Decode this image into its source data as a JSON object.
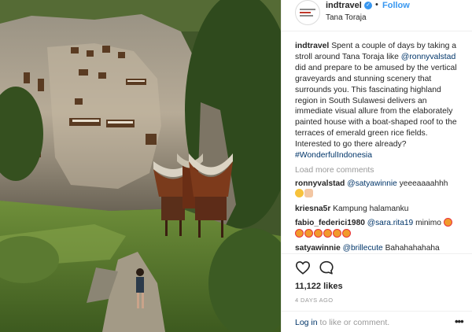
{
  "post": {
    "username": "indtravel",
    "follow_label": "Follow",
    "header_separator": "•",
    "location": "Tana Toraja",
    "verified_icon": "verified-badge-icon",
    "caption": {
      "username": "indtravel",
      "text_1": "Spent a couple of days by taking a stroll around Tana Toraja like",
      "mention": "@ronnyvalstad",
      "text_2": "did and prepare to be amused by the vertical graveyards and stunning scenery that surrounds you. This fascinating highland region in South Sulawesi delivers an immediate visual allure from the elaborately painted house with a boat-shaped roof to the terraces of emerald green rice fields. Interested to go there already?",
      "hashtag": "#WonderfulIndonesia"
    },
    "load_more": "Load more comments",
    "comments": [
      {
        "user": "ronnyvalstad",
        "mention": "@satyawinnie",
        "text": "yeeeaaaahhh",
        "emoji": [
          "grinning-face-emoji",
          "pointing-hand-emoji"
        ]
      },
      {
        "user": "kriesna5r",
        "mention": "",
        "text": "Kampung halamanku",
        "emoji": []
      },
      {
        "user": "fabio_federici1980",
        "mention": "@sara.rita19",
        "text": "minimo",
        "emoji": [
          "heart-eyes-emoji",
          "heart-eyes-emoji",
          "heart-eyes-emoji",
          "heart-eyes-emoji",
          "heart-eyes-emoji",
          "heart-eyes-emoji",
          "heart-eyes-emoji"
        ]
      },
      {
        "user": "satyawinnie",
        "mention": "@brillecute",
        "text": "Bahahahahaha",
        "emoji": []
      }
    ],
    "likes": "11,122 likes",
    "time_ago": "4 DAYS AGO",
    "login": {
      "link": "Log in",
      "text": "to like or comment."
    },
    "more_icon": "•••",
    "colors": {
      "accent_blue": "#3897f0",
      "link_dark": "#003569",
      "muted": "#999999",
      "text": "#262626",
      "border": "#efefef"
    }
  }
}
